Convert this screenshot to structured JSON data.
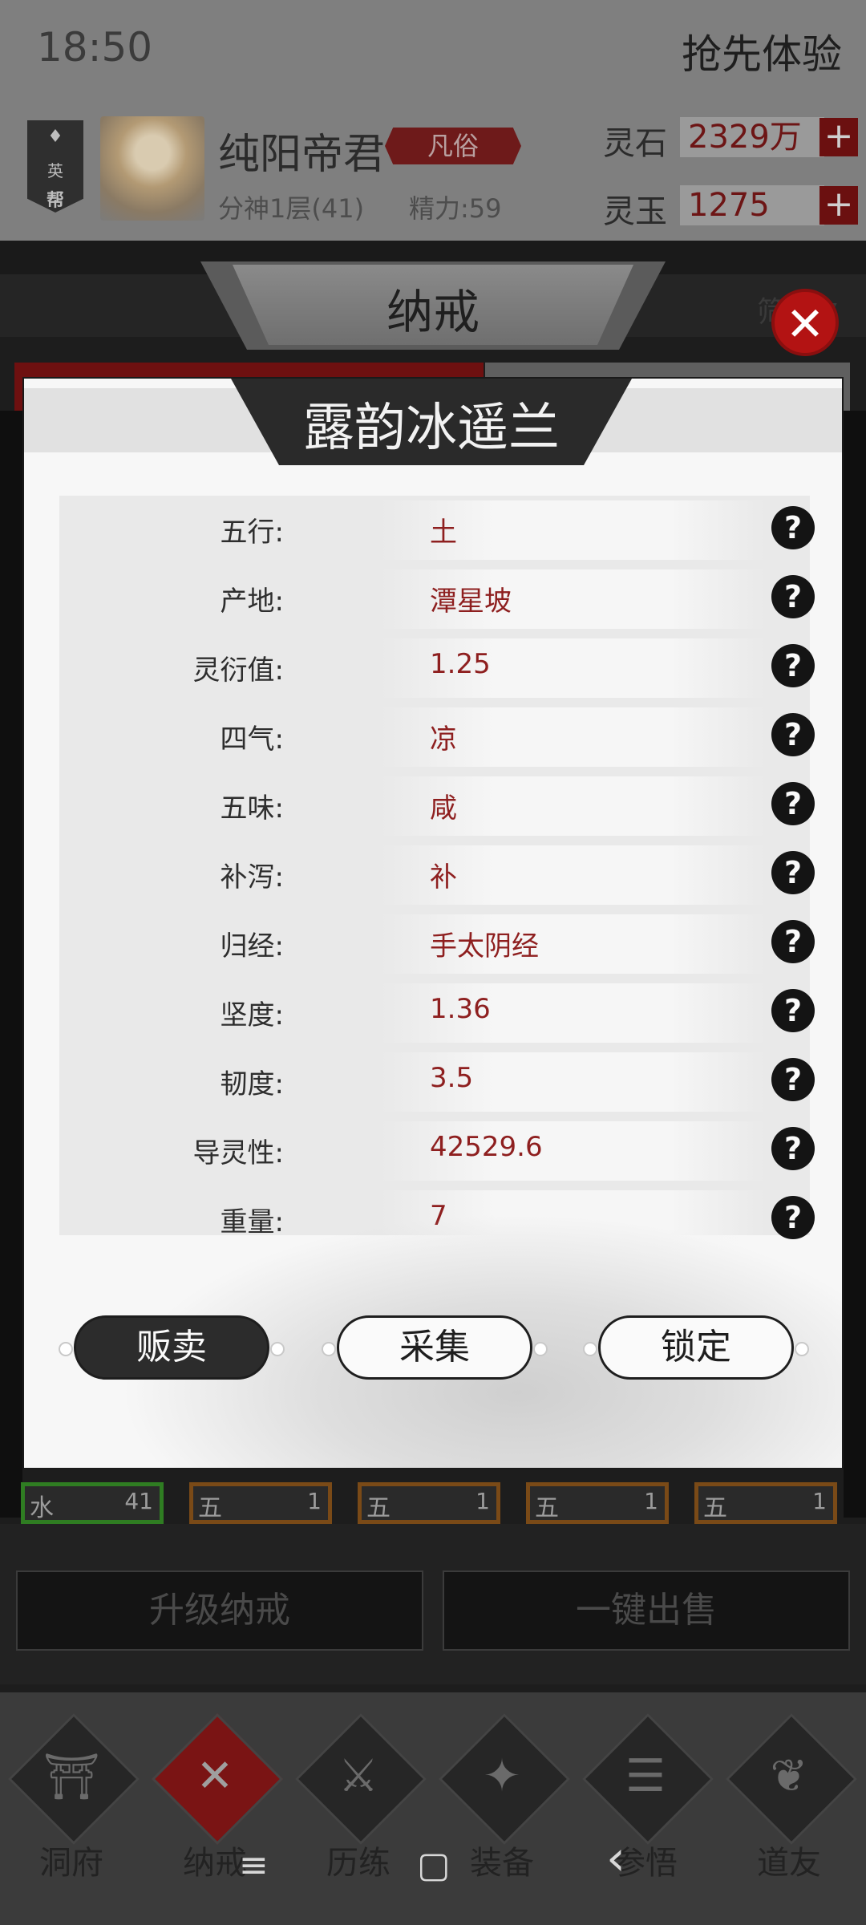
{
  "status_bar": {
    "time": "18:50",
    "action": "抢先体验"
  },
  "player": {
    "badge_top": "♦",
    "badge_mid": "英",
    "badge_bot": "帮",
    "name": "纯阳帝君",
    "rank": "凡俗",
    "cultivation": "分神1层(41)",
    "energy": "精力:59"
  },
  "currency": [
    {
      "label": "灵石",
      "value": "2329万",
      "plus": "+"
    },
    {
      "label": "灵玉",
      "value": "1275",
      "plus": "+"
    }
  ],
  "page": {
    "title": "纳戒",
    "filter": "筛选▽"
  },
  "modal": {
    "title": "露韵冰遥兰",
    "close": "✕",
    "rows": [
      {
        "label": "五行:",
        "value": "土",
        "help": "?"
      },
      {
        "label": "产地:",
        "value": "潭星坡",
        "help": "?"
      },
      {
        "label": "灵衍值:",
        "value": "1.25",
        "help": "?"
      },
      {
        "label": "四气:",
        "value": "凉",
        "help": "?"
      },
      {
        "label": "五味:",
        "value": "咸",
        "help": "?"
      },
      {
        "label": "补泻:",
        "value": "补",
        "help": "?"
      },
      {
        "label": "归经:",
        "value": "手太阴经",
        "help": "?"
      },
      {
        "label": "坚度:",
        "value": "1.36",
        "help": "?"
      },
      {
        "label": "韧度:",
        "value": "3.5",
        "help": "?"
      },
      {
        "label": "导灵性:",
        "value": "42529.6",
        "help": "?"
      },
      {
        "label": "重量:",
        "value": "7",
        "help": "?"
      }
    ],
    "actions": {
      "sell": "贩卖",
      "collect": "采集",
      "lock": "锁定"
    }
  },
  "slots": [
    {
      "kind": "水",
      "count": "41"
    },
    {
      "kind": "五",
      "count": "1"
    },
    {
      "kind": "五",
      "count": "1"
    },
    {
      "kind": "五",
      "count": "1"
    },
    {
      "kind": "五",
      "count": "1"
    }
  ],
  "bottom_actions": {
    "upgrade": "升级纳戒",
    "sell_all": "一键出售"
  },
  "nav": [
    {
      "label": "洞府",
      "icon": "gate-icon",
      "glyph": "⛩"
    },
    {
      "label": "纳戒",
      "icon": "ring-icon",
      "glyph": "✕"
    },
    {
      "label": "历练",
      "icon": "swords-icon",
      "glyph": "⚔"
    },
    {
      "label": "装备",
      "icon": "dagger-icon",
      "glyph": "✦"
    },
    {
      "label": "参悟",
      "icon": "book-icon",
      "glyph": "☰"
    },
    {
      "label": "道友",
      "icon": "handshake-icon",
      "glyph": "❦"
    }
  ],
  "system_nav": {
    "menu": "≡",
    "home": "▢",
    "back": "‹"
  }
}
